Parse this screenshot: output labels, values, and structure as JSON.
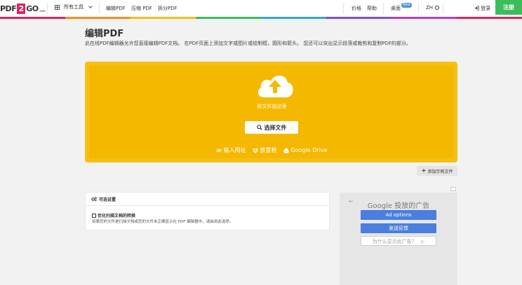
{
  "header": {
    "logo_left": "PDF",
    "logo_mid": "2",
    "logo_right": "GO",
    "logo_suffix": ".com",
    "all_tools": "所有工具",
    "nav": [
      "编辑PDF",
      "压缩 PDF",
      "拆分PDF"
    ],
    "pricing": "价格",
    "help": "帮助",
    "desktop": "桌面",
    "desktop_badge": "New",
    "language": "ZH",
    "login": "登录",
    "register": "注册"
  },
  "stripe_colors": [
    "#e0245e",
    "#f58f1d",
    "#f5c014",
    "#3cbd5c",
    "#2fa6d9",
    "#7b4fd6",
    "#c13fb4",
    "#e0245e"
  ],
  "main": {
    "title": "编辑PDF",
    "description": "此在线PDF编辑器允许您直接编辑PDF文档。 在PDF页面上添加文字或图片或绘制框，圆形和箭头。 您还可以突出显示段落或裁剪和复制PDF的部分。"
  },
  "dropzone": {
    "drop_text": "把文件放这里",
    "choose_button": "选择文件",
    "sources": [
      "输入网址",
      "放置框",
      "Google Drive"
    ],
    "color": "#f5b800"
  },
  "add_sample": "添加示例文件",
  "options": {
    "header": "可选设置",
    "checkbox_label": "优化扫描文档的转换",
    "checkbox_help": "如果您的文件是扫描文档或您的文件未正确显示在 PDF 编辑器中，请启用此选项。"
  },
  "ad": {
    "title": "Google 投放的广告",
    "ad_options": "Ad options",
    "feedback": "发送反馈",
    "why": "为什么显示此广告？"
  }
}
